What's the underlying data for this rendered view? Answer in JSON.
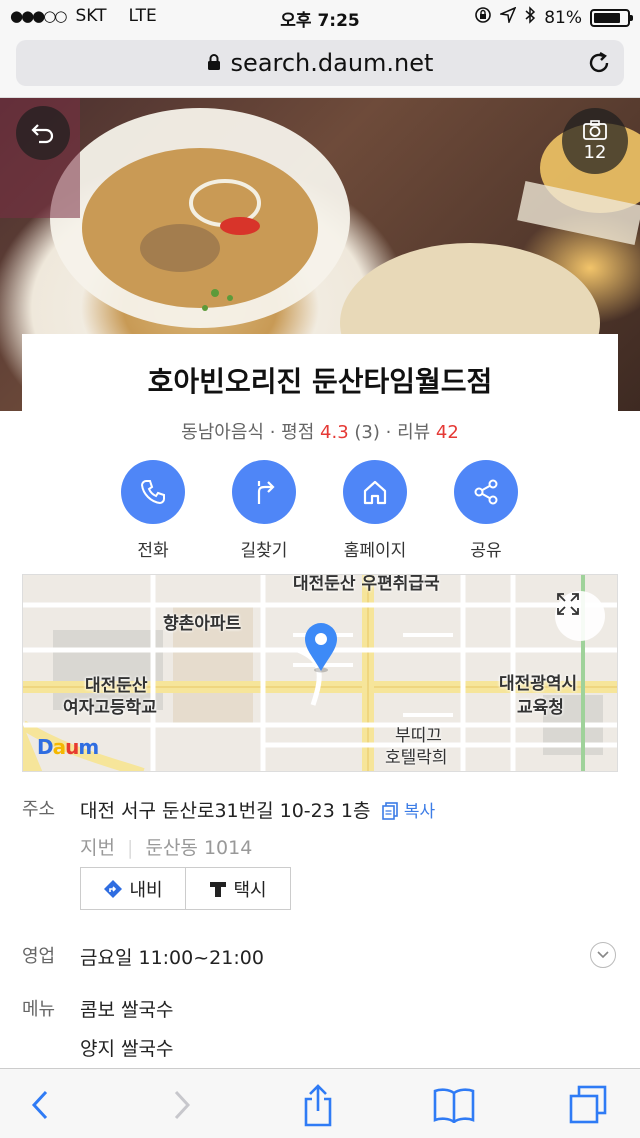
{
  "status_bar": {
    "carrier": "SKT",
    "network": "LTE",
    "time": "오후 7:25",
    "battery": "81%",
    "battery_level": 0.81
  },
  "browser": {
    "url": "search.daum.net"
  },
  "hero": {
    "photo_count": "12"
  },
  "place": {
    "name": "호아빈오리진 둔산타임월드점",
    "category": "동남아음식",
    "rating_label": "평점",
    "rating": "4.3",
    "rating_count": "(3)",
    "review_label": "리뷰",
    "review_count": "42"
  },
  "actions": [
    {
      "label": "전화",
      "icon": "phone-icon"
    },
    {
      "label": "길찾기",
      "icon": "directions-icon"
    },
    {
      "label": "홈페이지",
      "icon": "home-icon"
    },
    {
      "label": "공유",
      "icon": "share-icon"
    }
  ],
  "map": {
    "labels": [
      "대전둔산 우편취급국",
      "향촌아파트",
      "대전둔산",
      "여자고등학교",
      "대전광역시",
      "교육청",
      "부띠끄",
      "호텔락희"
    ],
    "logo": "Daum"
  },
  "details": {
    "address_label": "주소",
    "address": "대전 서구 둔산로31번길 10-23 1층",
    "copy_label": "복사",
    "jibun_label": "지번",
    "jibun": "둔산동 1014",
    "navi_label": "내비",
    "taxi_label": "택시",
    "hours_label": "영업",
    "hours": "금요일 11:00~21:00",
    "menu_label": "메뉴",
    "menu_items": [
      "콤보 쌀국수",
      "양지 쌀국수"
    ]
  },
  "colors": {
    "accent": "#4f86f7",
    "highlight": "#e53935",
    "link": "#3c7ce6"
  }
}
